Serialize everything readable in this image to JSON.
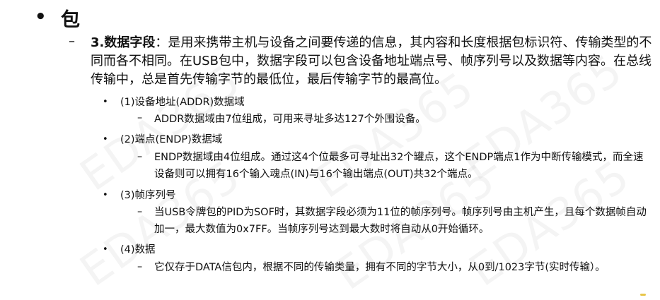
{
  "watermark": "EDA365",
  "heading": {
    "bullet": "•",
    "title": "包"
  },
  "paragraph": {
    "dash": "–",
    "lead": "3.数据字段",
    "text": "：是用来携带主机与设备之间要传递的信息，其内容和长度根据包标识符、传输类型的不同而各不相同。在USB包中，数据字段可以包含设备地址端点号、帧序列号以及数据等内容。在总线传输中，总是首先传输字节的最低位，最后传输字节的最高位。"
  },
  "items": [
    {
      "bullet": "•",
      "title": "(1)设备地址(ADDR)数据域",
      "dash": "–",
      "detail": "ADDR数据域由7位组成，可用来寻址多达127个外围设备。"
    },
    {
      "bullet": "•",
      "title": "(2)端点(ENDP)数据域",
      "dash": "–",
      "detail": "ENDP数据域由4位组成。通过这4个位最多可寻址出32个罐点，这个ENDP端点1作为中断传输模式，而全速设备则可以拥有16个输入魂点(IN)与16个输出端点(OUT)共32个端点。"
    },
    {
      "bullet": "•",
      "title": "(3)帧序列号",
      "dash": "–",
      "detail": "当USB令牌包的PID为SOF时，其数据字段必须为11位的帧序列号。帧序列号由主机产生，且每个数据帧自动加一，最大数值为0x7FF。当帧序列号达到最大数时将自动从0开始循环。"
    },
    {
      "bullet": "•",
      "title": "(4)数据",
      "dash": "–",
      "detail": "它仅存于DATA信包内，根据不同的传输类量，拥有不同的字节大小，从0到/1023字节(实时传输）。"
    }
  ]
}
